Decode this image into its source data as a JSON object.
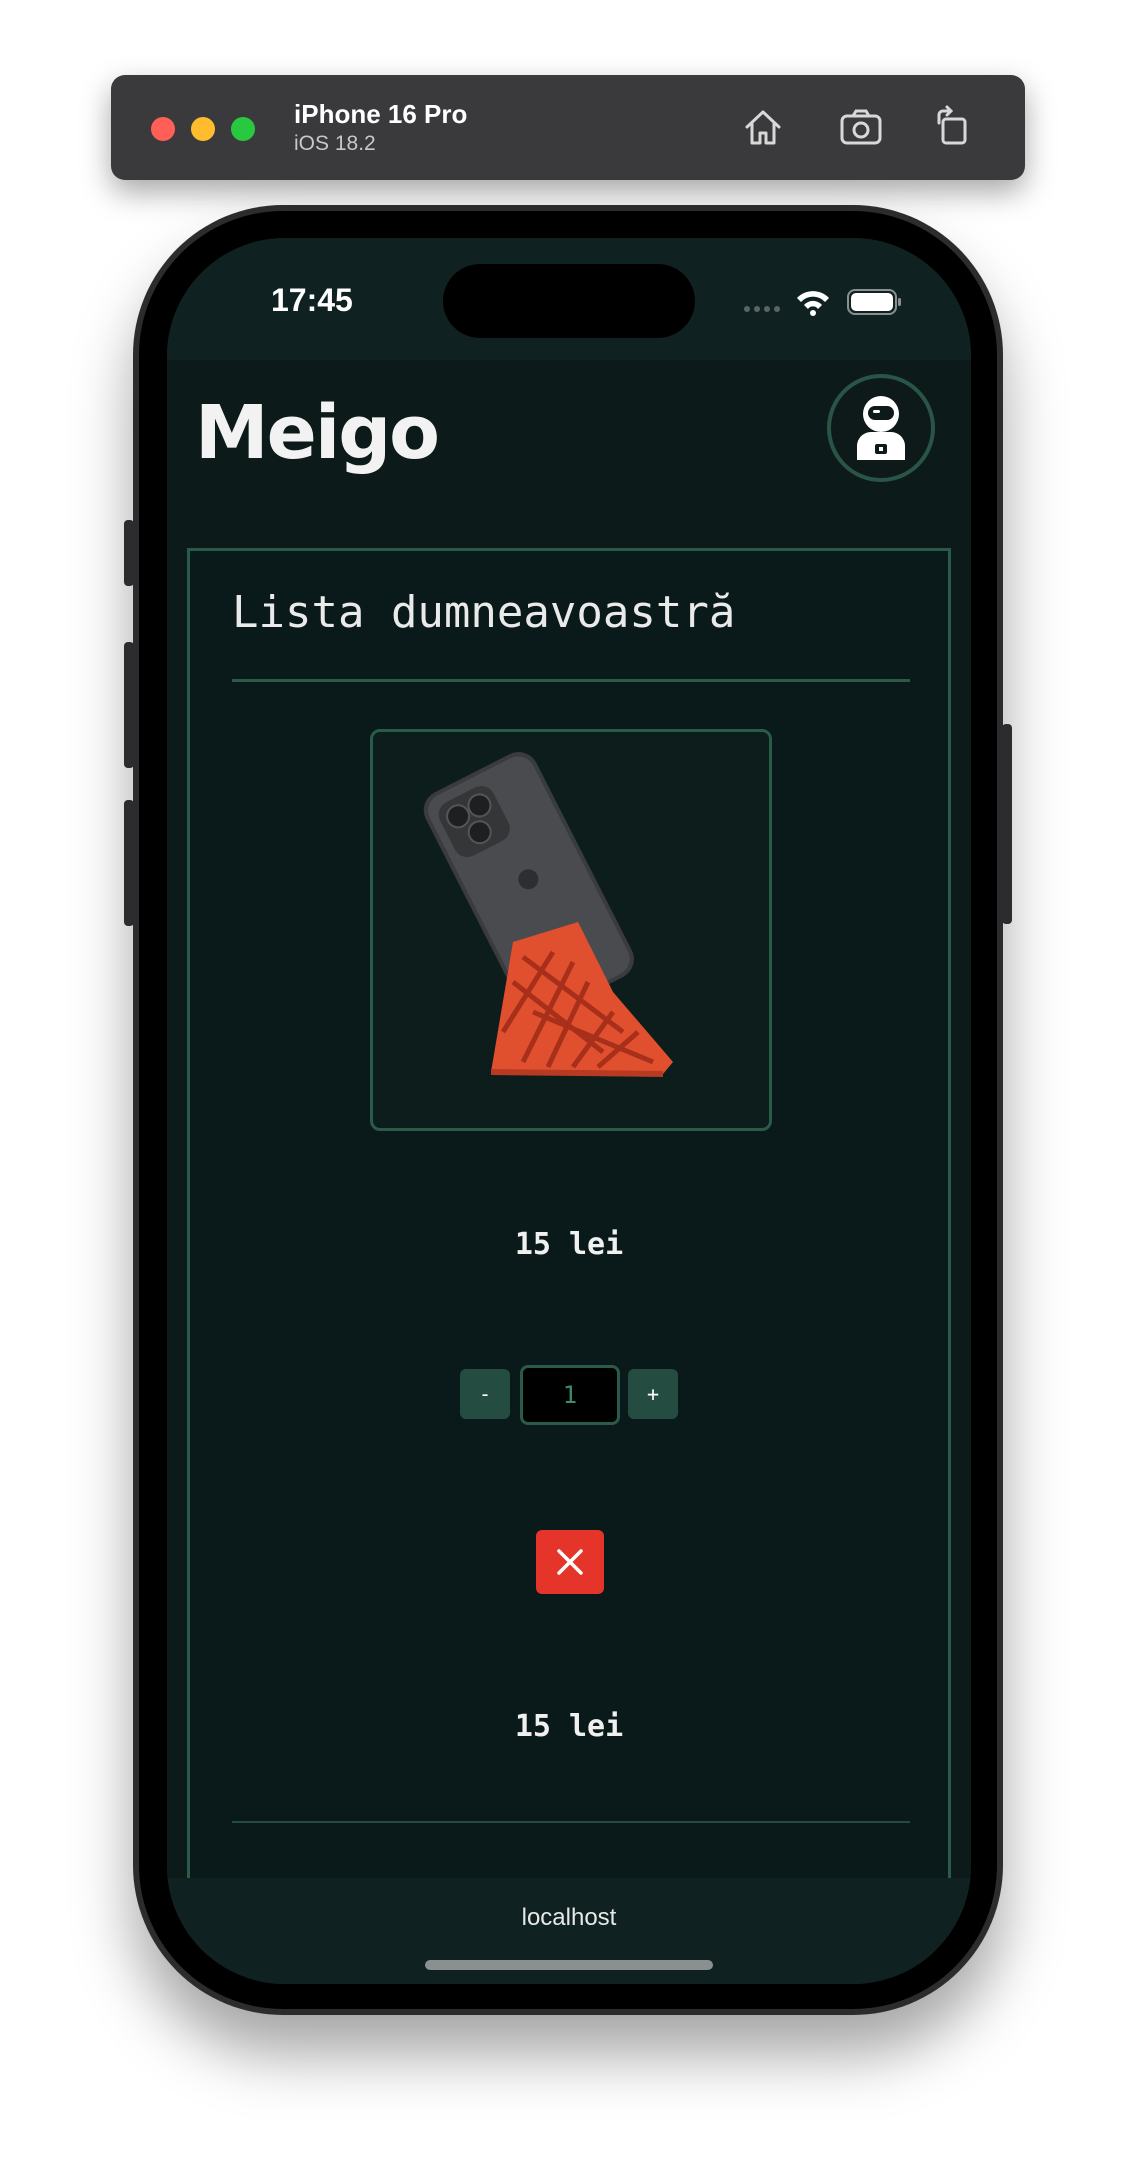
{
  "simulator": {
    "device_name": "iPhone 16 Pro",
    "os_version": "iOS 18.2",
    "icons": [
      "home-icon",
      "screenshot-icon",
      "rotate-icon"
    ]
  },
  "status_bar": {
    "time": "17:45",
    "icons": [
      "signal-icon",
      "wifi-icon",
      "battery-icon"
    ]
  },
  "header": {
    "logo": "Meigo",
    "avatar_icon": "astronaut-icon"
  },
  "cart": {
    "title": "Lista dumneavoastră",
    "item": {
      "image": "phone-stand-product-image",
      "price": "15 lei",
      "quantity": "1",
      "minus_label": "-",
      "plus_label": "+",
      "remove_icon": "close-icon",
      "subtotal": "15 lei"
    }
  },
  "browser": {
    "url": "localhost"
  },
  "colors": {
    "background": "#0c1a1a",
    "accent": "#2a5a48",
    "danger": "#e5342a"
  }
}
